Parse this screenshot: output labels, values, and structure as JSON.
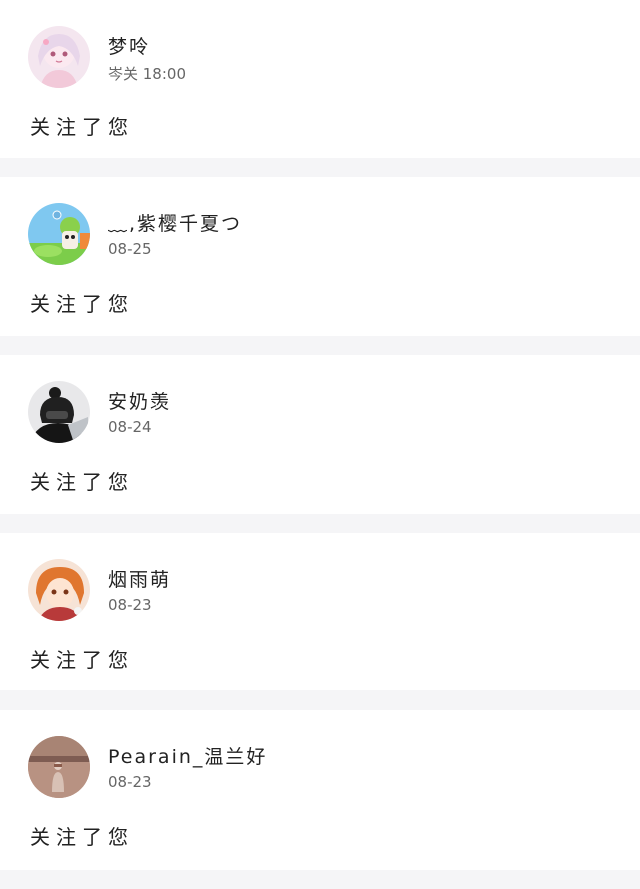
{
  "notifications": [
    {
      "name": "梦呤",
      "time": "岑关 18:00",
      "message": "关注了您",
      "avatar": "anime-girl-pink-avatar"
    },
    {
      "name": "﹏,紫樱千夏つ",
      "time": "08-25",
      "message": "关注了您",
      "avatar": "green-cartoon-character-avatar"
    },
    {
      "name": "安奶羡",
      "time": "08-24",
      "message": "关注了您",
      "avatar": "masked-figure-dark-avatar"
    },
    {
      "name": "烟雨萌",
      "time": "08-23",
      "message": "关注了您",
      "avatar": "anime-orange-hair-avatar"
    },
    {
      "name": "Pearain_温兰好",
      "time": "08-23",
      "message": "关注了您",
      "avatar": "sunset-figure-avatar"
    }
  ]
}
